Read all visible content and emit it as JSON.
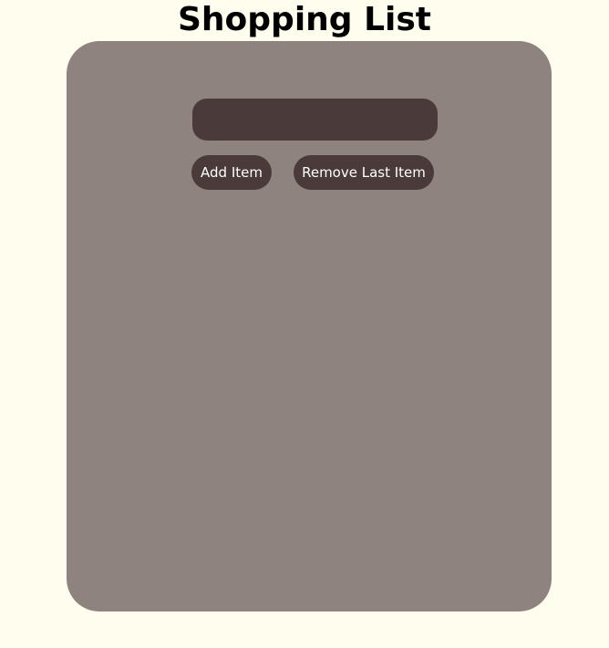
{
  "page": {
    "title": "Shopping List"
  },
  "form": {
    "item_input": {
      "value": "",
      "placeholder": ""
    },
    "add_label": "Add Item",
    "remove_label": "Remove Last Item"
  },
  "list": {
    "items": []
  },
  "colors": {
    "page_background": "#fffdee",
    "panel_background": "#8e837e",
    "control_background": "#4a3a3a",
    "control_text": "#ffffff",
    "title_text": "#000000"
  }
}
